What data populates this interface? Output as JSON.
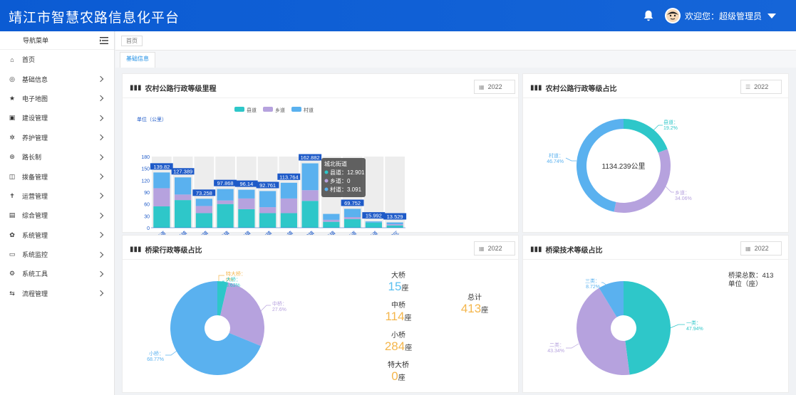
{
  "header": {
    "title": "靖江市智慧农路信息化平台",
    "welcome": "欢迎您：",
    "user": "超级管理员"
  },
  "sidebar": {
    "head": "导航菜单",
    "items": [
      {
        "label": "首页",
        "icon": "⌂",
        "arrow": false
      },
      {
        "label": "基础信息",
        "icon": "◎",
        "arrow": true
      },
      {
        "label": "电子地图",
        "icon": "★",
        "arrow": true
      },
      {
        "label": "建设管理",
        "icon": "▣",
        "arrow": true
      },
      {
        "label": "养护管理",
        "icon": "✲",
        "arrow": true
      },
      {
        "label": "路长制",
        "icon": "⊛",
        "arrow": true
      },
      {
        "label": "拨备管理",
        "icon": "◫",
        "arrow": true
      },
      {
        "label": "运营管理",
        "icon": "✝",
        "arrow": true
      },
      {
        "label": "综合管理",
        "icon": "▤",
        "arrow": true
      },
      {
        "label": "系统管理",
        "icon": "✿",
        "arrow": true
      },
      {
        "label": "系统监控",
        "icon": "▭",
        "arrow": true
      },
      {
        "label": "系统工具",
        "icon": "⚙",
        "arrow": true
      },
      {
        "label": "流程管理",
        "icon": "⇆",
        "arrow": true
      }
    ]
  },
  "breadcrumb": "首页",
  "tab": "基础信息",
  "colors": {
    "teal": "#2ec7c9",
    "purple": "#b6a2de",
    "blue": "#5ab1ef",
    "orange": "#f4b64c",
    "label_blue": "#1e5ac8"
  },
  "panels": {
    "road_grade": {
      "title": "农村公路行政等级里程",
      "year": "2022"
    },
    "road_ratio": {
      "title": "农村公路行政等级占比",
      "year": "2022"
    },
    "bridge_admin": {
      "title": "桥梁行政等级占比",
      "year": "2022"
    },
    "bridge_tech": {
      "title": "桥梁技术等级占比",
      "year": "2022"
    }
  },
  "bar_tooltip": {
    "title": "城北街道",
    "rows": [
      {
        "name": "县道",
        "value": "12.901"
      },
      {
        "name": "乡道",
        "value": "0"
      },
      {
        "name": "村道",
        "value": "3.091"
      }
    ]
  },
  "road_ratio_center": "1134.239公里",
  "bridge_stats": {
    "items": [
      {
        "label": "大桥",
        "value": "15",
        "unit": "座"
      },
      {
        "label": "中桥",
        "value": "114",
        "unit": "座"
      },
      {
        "label": "小桥",
        "value": "284",
        "unit": "座"
      },
      {
        "label": "特大桥",
        "value": "0",
        "unit": "座"
      }
    ],
    "total": {
      "label": "总计",
      "value": "413",
      "unit": "座"
    }
  },
  "bridge_tech_note": {
    "line1": "桥梁总数：413",
    "line2": "单位（座）"
  },
  "chart_data": [
    {
      "type": "bar",
      "title": "农村公路行政等级里程",
      "ylabel": "单位（公里）",
      "ylim": [
        0,
        180
      ],
      "yticks": [
        0,
        30,
        60,
        90,
        120,
        150,
        180
      ],
      "categories": [
        "靖城街道",
        "新桥镇",
        "东兴镇",
        "斜桥镇",
        "西来镇",
        "季市镇",
        "孤山镇",
        "生祠镇",
        "马桥镇",
        "城南街道",
        "城北街道",
        "江阴园区"
      ],
      "series": [
        {
          "name": "县道",
          "values": [
            54,
            70,
            37,
            60,
            47,
            37,
            37,
            68,
            15,
            22,
            13,
            6
          ]
        },
        {
          "name": "乡道",
          "values": [
            46,
            14,
            18,
            9,
            27,
            15,
            37,
            27,
            5,
            5,
            0,
            3
          ]
        },
        {
          "name": "村道",
          "values": [
            39.82,
            43.389,
            18.258,
            28.868,
            22.14,
            40.761,
            39.764,
            67.882,
            15,
            20.752,
            2.992,
            4.529
          ]
        }
      ],
      "totals": [
        "139.82",
        "127.389",
        "73.258",
        "97.868",
        "96.14",
        "92.761",
        "113.764",
        "162.882",
        "",
        "69.752",
        "15.992",
        "13.529"
      ],
      "legend": "top"
    },
    {
      "type": "pie",
      "title": "农村公路行政等级占比",
      "slices": [
        {
          "name": "县道",
          "percent": "19.2%",
          "value": 19.2
        },
        {
          "name": "乡道",
          "percent": "34.06%",
          "value": 34.06
        },
        {
          "name": "村道",
          "percent": "46.74%",
          "value": 46.74
        }
      ]
    },
    {
      "type": "pie",
      "title": "桥梁行政等级占比",
      "slices": [
        {
          "name": "特大桥",
          "percent": "0%",
          "value": 0
        },
        {
          "name": "大桥",
          "percent": "3.63%",
          "value": 3.63
        },
        {
          "name": "中桥",
          "percent": "27.6%",
          "value": 27.6
        },
        {
          "name": "小桥",
          "percent": "68.77%",
          "value": 68.77
        }
      ]
    },
    {
      "type": "pie",
      "title": "桥梁技术等级占比",
      "slices": [
        {
          "name": "一类",
          "percent": "47.94%",
          "value": 47.94
        },
        {
          "name": "二类",
          "percent": "43.34%",
          "value": 43.34
        },
        {
          "name": "三类",
          "percent": "8.72%",
          "value": 8.72
        }
      ]
    }
  ]
}
